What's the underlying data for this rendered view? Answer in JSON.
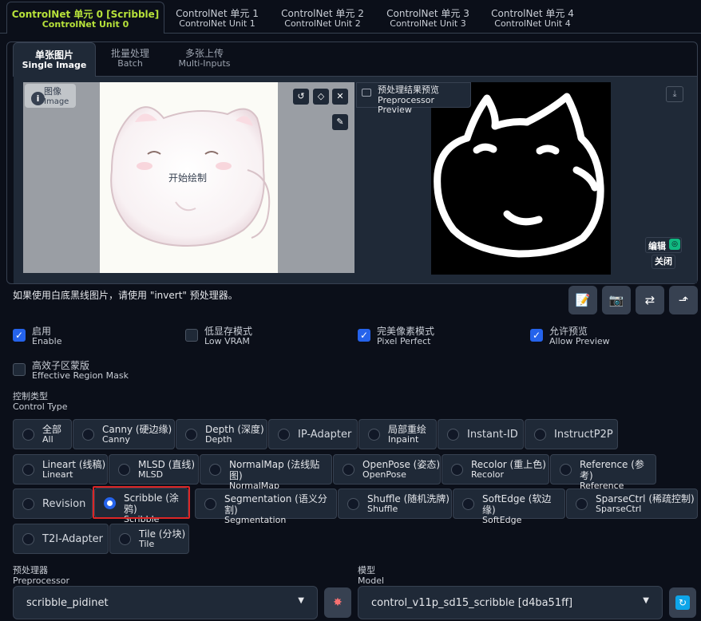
{
  "unit_tabs": [
    {
      "zh": "ControlNet 单元 0 [Scribble]",
      "en": "ControlNet Unit 0"
    },
    {
      "zh": "ControlNet 单元 1",
      "en": "ControlNet Unit 1"
    },
    {
      "zh": "ControlNet 单元 2",
      "en": "ControlNet Unit 2"
    },
    {
      "zh": "ControlNet 单元 3",
      "en": "ControlNet Unit 3"
    },
    {
      "zh": "ControlNet 单元 4",
      "en": "ControlNet Unit 4"
    }
  ],
  "mode_tabs": [
    {
      "zh": "单张图片",
      "en": "Single Image"
    },
    {
      "zh": "批量处理",
      "en": "Batch"
    },
    {
      "zh": "多张上传",
      "en": "Multi-Inputs"
    }
  ],
  "image_panel": {
    "label_zh": "图像",
    "label_en": "Image",
    "start_draw": "开始绘制",
    "badge": "i"
  },
  "preview_panel": {
    "label_zh": "预处理结果预览",
    "label_en": "Preprocessor Preview",
    "edit": "编辑",
    "close": "关闭"
  },
  "note": "如果使用白底黑线图片，请使用 \"invert\" 预处理器。",
  "checkboxes": [
    {
      "zh": "启用",
      "en": "Enable",
      "checked": true
    },
    {
      "zh": "低显存模式",
      "en": "Low VRAM",
      "checked": false
    },
    {
      "zh": "完美像素模式",
      "en": "Pixel Perfect",
      "checked": true
    },
    {
      "zh": "允许预览",
      "en": "Allow Preview",
      "checked": true
    },
    {
      "zh": "高效子区蒙版",
      "en": "Effective Region Mask",
      "checked": false
    }
  ],
  "control_type": {
    "label_zh": "控制类型",
    "label_en": "Control Type"
  },
  "control_types": [
    {
      "zh": "全部",
      "en": "All"
    },
    {
      "zh": "Canny (硬边缘)",
      "en": "Canny"
    },
    {
      "zh": "Depth (深度)",
      "en": "Depth"
    },
    {
      "zh": "IP-Adapter",
      "en": ""
    },
    {
      "zh": "局部重绘",
      "en": "Inpaint"
    },
    {
      "zh": "Instant-ID",
      "en": ""
    },
    {
      "zh": "InstructP2P",
      "en": ""
    },
    {
      "zh": "Lineart (线稿)",
      "en": "Lineart"
    },
    {
      "zh": "MLSD (直线)",
      "en": "MLSD"
    },
    {
      "zh": "NormalMap (法线贴图)",
      "en": "NormalMap"
    },
    {
      "zh": "OpenPose (姿态)",
      "en": "OpenPose"
    },
    {
      "zh": "Recolor (重上色)",
      "en": "Recolor"
    },
    {
      "zh": "Reference (参考)",
      "en": "Reference"
    },
    {
      "zh": "Revision",
      "en": ""
    },
    {
      "zh": "Scribble (涂鸦)",
      "en": "Scribble",
      "selected": true
    },
    {
      "zh": "Segmentation (语义分割)",
      "en": "Segmentation"
    },
    {
      "zh": "Shuffle (随机洗牌)",
      "en": "Shuffle"
    },
    {
      "zh": "SoftEdge (软边缘)",
      "en": "SoftEdge"
    },
    {
      "zh": "SparseCtrl (稀疏控制)",
      "en": "SparseCtrl"
    },
    {
      "zh": "T2I-Adapter",
      "en": ""
    },
    {
      "zh": "Tile (分块)",
      "en": "Tile"
    }
  ],
  "preprocessor": {
    "label_zh": "预处理器",
    "label_en": "Preprocessor",
    "value": "scribble_pidinet"
  },
  "model": {
    "label_zh": "模型",
    "label_en": "Model",
    "value": "control_v11p_sd15_scribble [d4ba51ff]"
  }
}
